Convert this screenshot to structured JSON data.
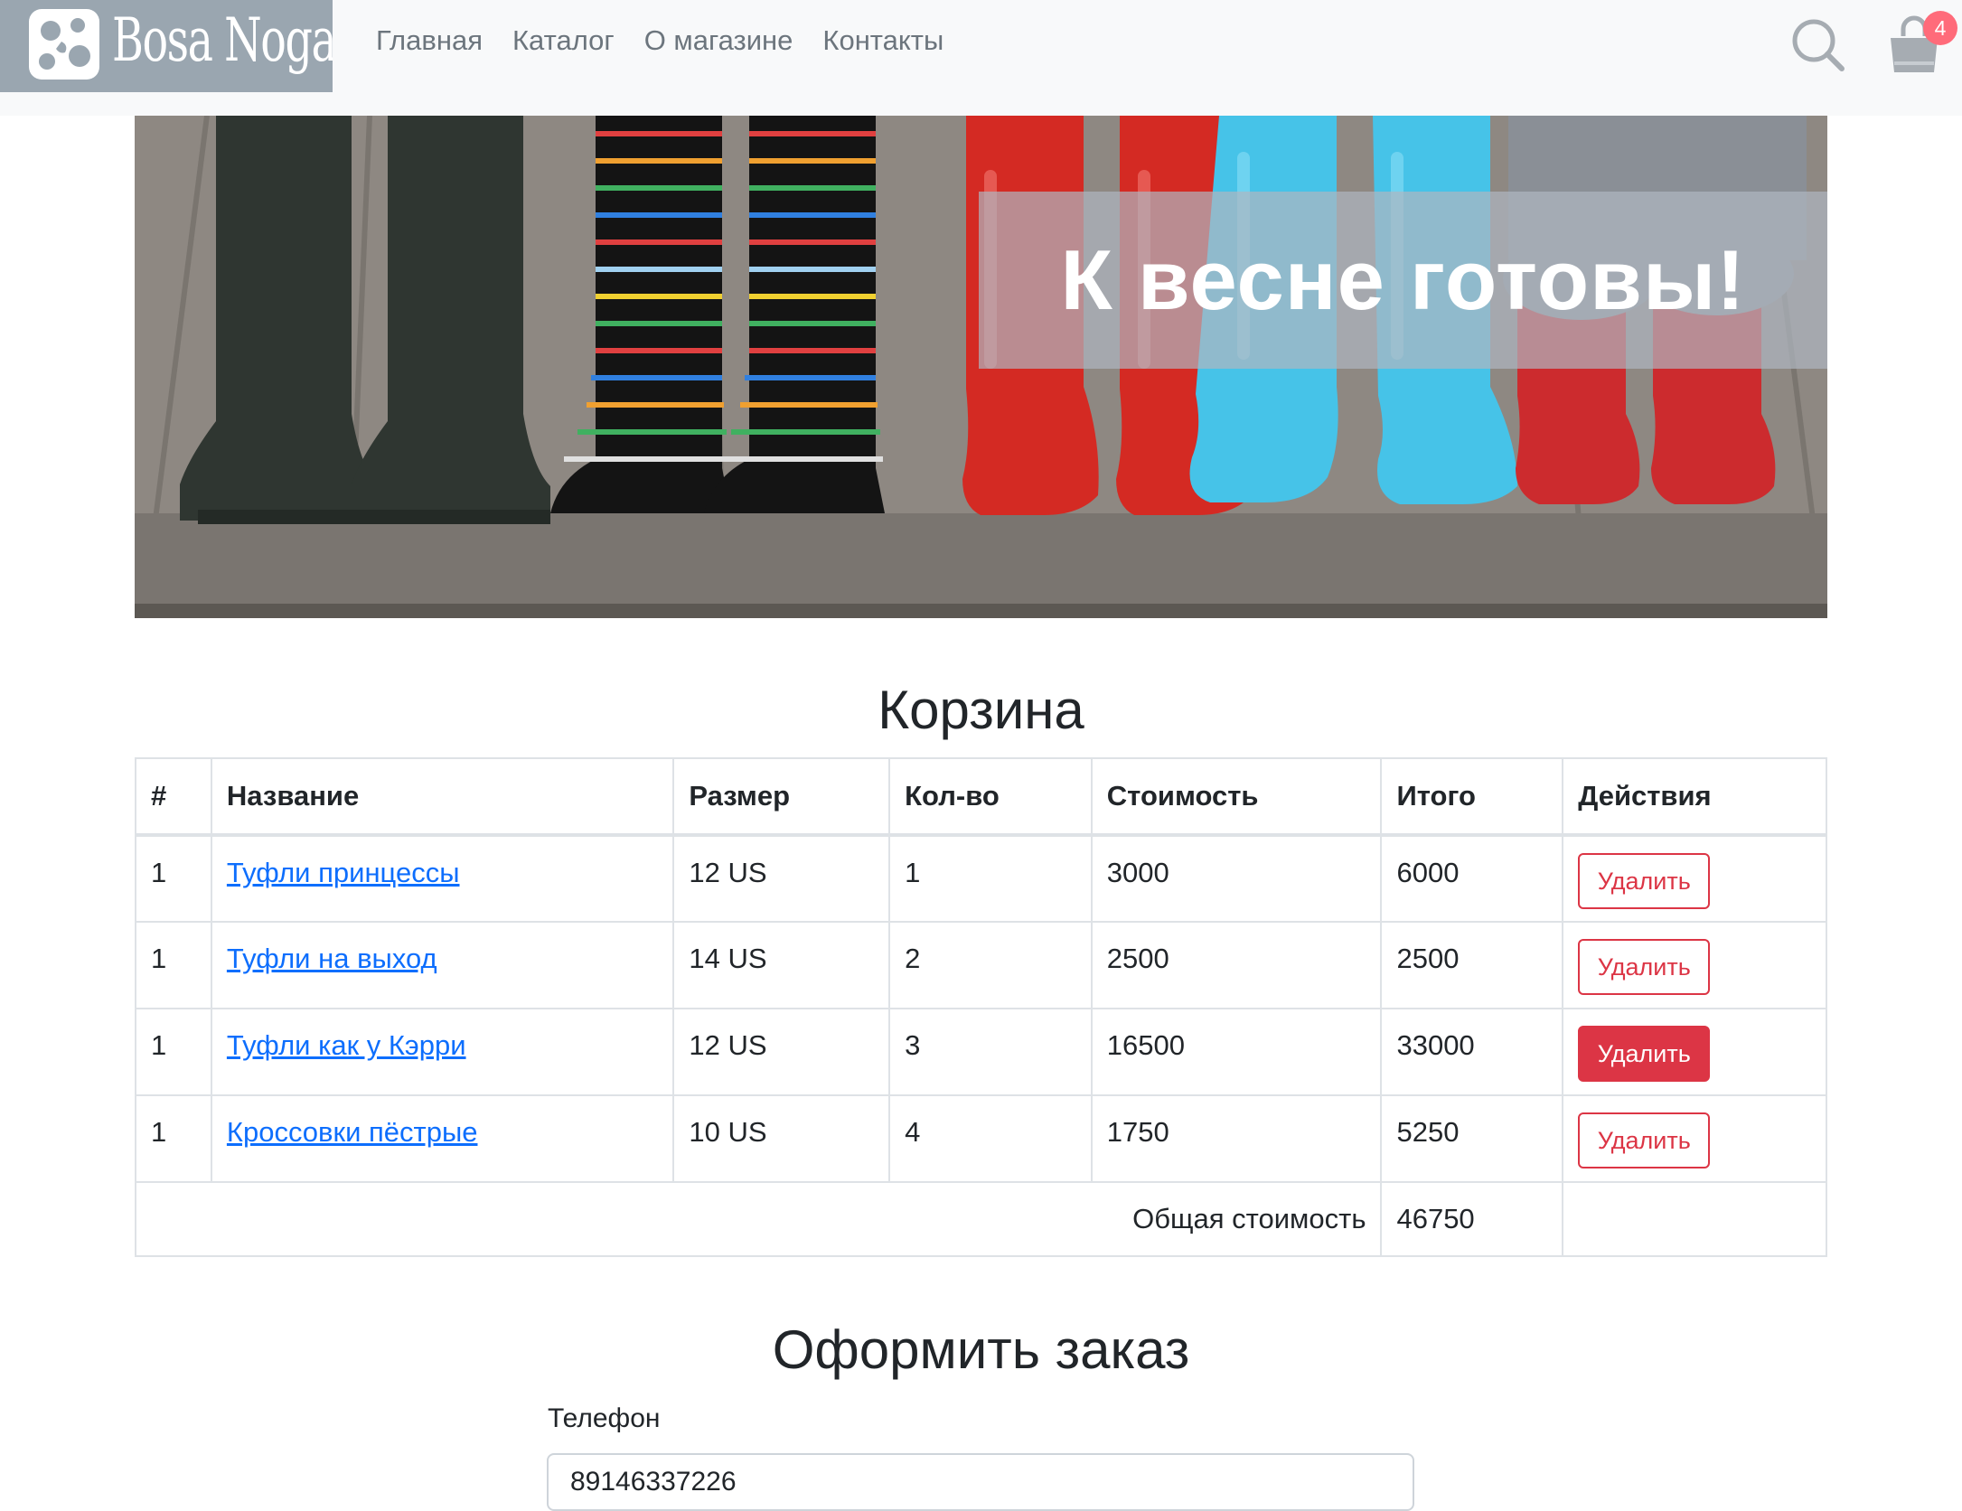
{
  "brand": {
    "name": "Bosa Noga",
    "logo_bg": "#9aa6b0"
  },
  "nav": {
    "items": [
      {
        "label": "Главная"
      },
      {
        "label": "Каталог"
      },
      {
        "label": "О магазине"
      },
      {
        "label": "Контакты"
      }
    ],
    "search_icon": "search-icon",
    "cart_icon": "shopping-bag-icon",
    "cart_count": "4",
    "badge_color": "#ff6b7a"
  },
  "banner": {
    "title": "К весне готовы!"
  },
  "cart": {
    "heading": "Корзина",
    "columns": [
      "#",
      "Название",
      "Размер",
      "Кол-во",
      "Стоимость",
      "Итого",
      "Действия"
    ],
    "rows": [
      {
        "num": "1",
        "name": "Туфли принцессы",
        "size": "12 US",
        "qty": "1",
        "price": "3000",
        "total": "6000",
        "action": "Удалить"
      },
      {
        "num": "1",
        "name": "Туфли на выход",
        "size": "14 US",
        "qty": "2",
        "price": "2500",
        "total": "2500",
        "action": "Удалить"
      },
      {
        "num": "1",
        "name": "Туфли как у Кэрри",
        "size": "12 US",
        "qty": "3",
        "price": "16500",
        "total": "33000",
        "action": "Удалить"
      },
      {
        "num": "1",
        "name": "Кроссовки пёстрые",
        "size": "10 US",
        "qty": "4",
        "price": "1750",
        "total": "5250",
        "action": "Удалить"
      }
    ],
    "total_label": "Общая стоимость",
    "total_value": "46750",
    "delete_color": "#dc3545",
    "link_color": "#0d6efd"
  },
  "order": {
    "heading": "Оформить заказ",
    "phone_label": "Телефон",
    "phone_value": "89146337226"
  }
}
